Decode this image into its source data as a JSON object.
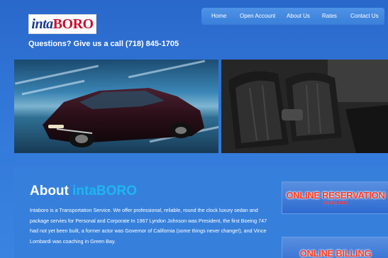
{
  "brand": {
    "logo_part1": "inta",
    "logo_part2": "BORO"
  },
  "header": {
    "phone_text": "Questions? Give us a call (718) 845-1705"
  },
  "nav": {
    "items": [
      "Home",
      "Open Account",
      "About Us",
      "Rates",
      "Contact Us"
    ]
  },
  "about": {
    "title_prefix": "About",
    "title_accent": "intaBORO",
    "body": "Intaboro is a Transportation Service. We offer professional, reliable, round the clock luxury sedan and package servies for Personal and Corporate In 1967 Lyndon Johnson was President, the first Boeing 747 had not yet been built, a former actor was Governor of California (some things never change!), and Vince Lombardi was coaching in Green Bay."
  },
  "actions": {
    "reservation_title": "ONLINE RESERVATION",
    "reservation_sub": "CLICK HERE",
    "billing_title": "ONLINE BILLING"
  },
  "colors": {
    "background": "#2f6fd0",
    "accent_text": "#1fb6f0",
    "button_title": "#ff3b1f"
  },
  "images": [
    "luxury-sedan-photo",
    "limo-interior-photo"
  ]
}
